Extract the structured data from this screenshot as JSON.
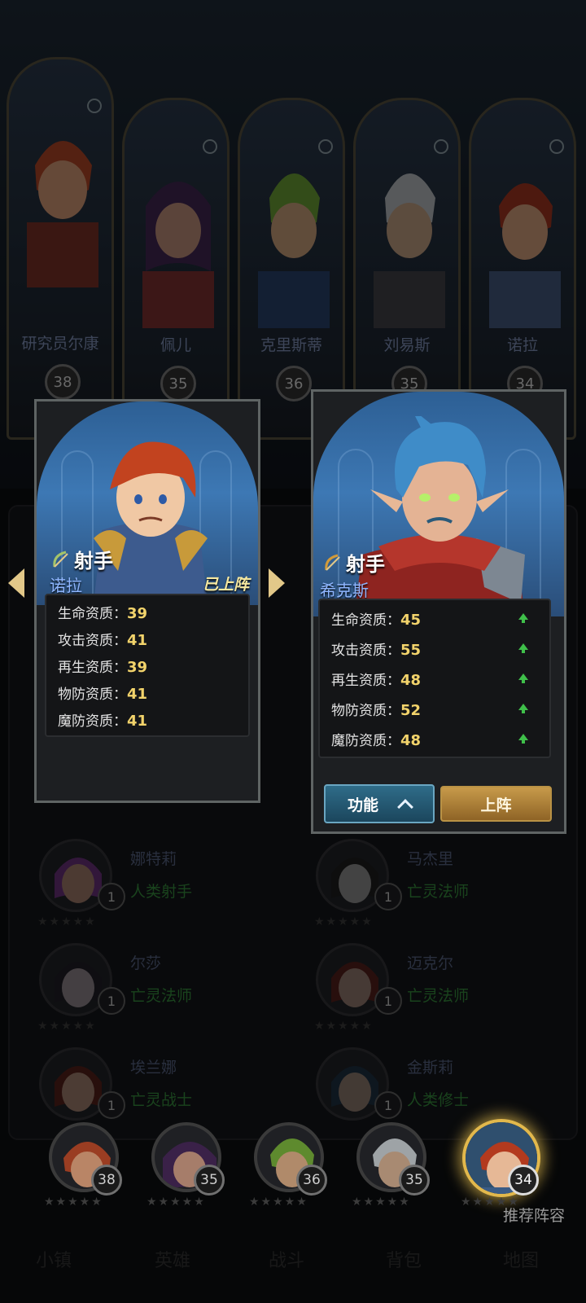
{
  "top_heroes": [
    {
      "name": "研究员尔康",
      "level": "38"
    },
    {
      "name": "佩儿",
      "level": "35"
    },
    {
      "name": "克里斯蒂",
      "level": "36"
    },
    {
      "name": "刘易斯",
      "level": "35"
    },
    {
      "name": "诺拉",
      "level": "34"
    }
  ],
  "current_hero": {
    "role": "射手",
    "name": "诺拉",
    "status": "已上阵",
    "stats": [
      {
        "label": "生命资质：",
        "value": "39"
      },
      {
        "label": "攻击资质：",
        "value": "41"
      },
      {
        "label": "再生资质：",
        "value": "39"
      },
      {
        "label": "物防资质：",
        "value": "41"
      },
      {
        "label": "魔防资质：",
        "value": "41"
      }
    ]
  },
  "compare_hero": {
    "role": "射手",
    "name": "希克斯",
    "stats": [
      {
        "label": "生命资质：",
        "value": "45"
      },
      {
        "label": "攻击资质：",
        "value": "55"
      },
      {
        "label": "再生资质：",
        "value": "48"
      },
      {
        "label": "物防资质：",
        "value": "52"
      },
      {
        "label": "魔防资质：",
        "value": "48"
      }
    ],
    "function_button": "功能",
    "deploy_button": "上阵"
  },
  "hero_list": [
    {
      "name": "娜特莉",
      "class": "人类射手",
      "level": "1"
    },
    {
      "name": "马杰里",
      "class": "亡灵法师",
      "level": "1"
    },
    {
      "name": "尔莎",
      "class": "亡灵法师",
      "level": "1"
    },
    {
      "name": "迈克尔",
      "class": "亡灵法师",
      "level": "1"
    },
    {
      "name": "埃兰娜",
      "class": "亡灵战士",
      "level": "1"
    },
    {
      "name": "金斯莉",
      "class": "人类修士",
      "level": "1"
    }
  ],
  "team": [
    {
      "level": "38"
    },
    {
      "level": "35"
    },
    {
      "level": "36"
    },
    {
      "level": "35"
    },
    {
      "level": "34"
    }
  ],
  "recommend_label": "推荐阵容",
  "bottom_nav": [
    "小镇",
    "英雄",
    "战斗",
    "背包",
    "地图"
  ],
  "colors": {
    "accent_gold": "#e2b84c",
    "stat_value": "#f2d36b",
    "up_arrow": "#3fbf4a",
    "name_blue": "#8fb6ff"
  }
}
